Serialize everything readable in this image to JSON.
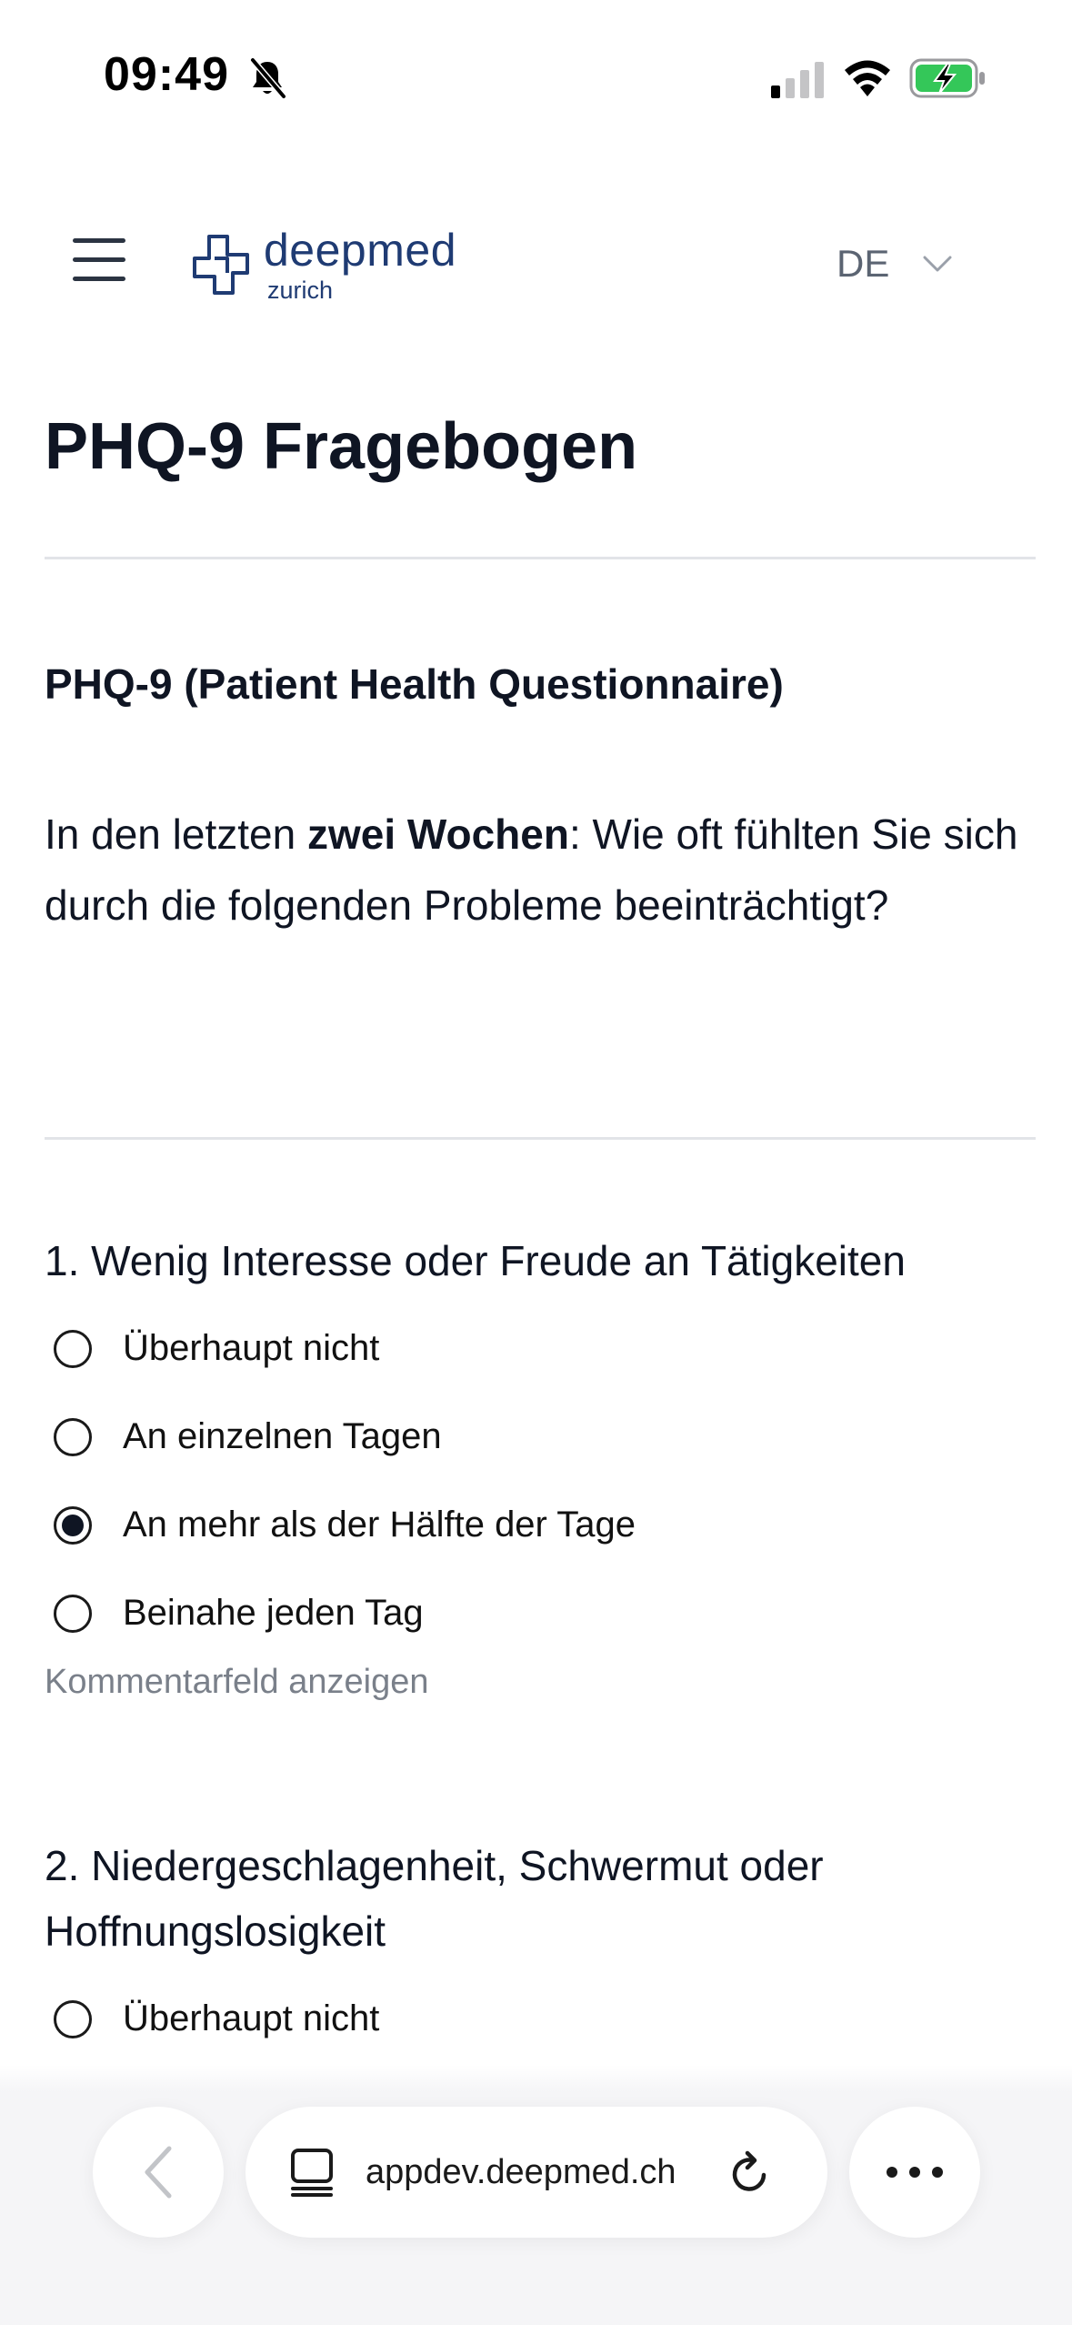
{
  "status_bar": {
    "time": "09:49",
    "icons": [
      "bell-slash-icon",
      "cellular-signal-icon",
      "wifi-icon",
      "battery-charging-icon"
    ],
    "battery_color": "#34c759"
  },
  "header": {
    "menu_icon": "hamburger-menu-icon",
    "logo": {
      "name": "deepmed",
      "sub": "zurich",
      "color": "#1f3b73"
    },
    "language": {
      "selected": "DE"
    }
  },
  "main": {
    "title": "PHQ-9 Fragebogen",
    "intro": {
      "heading": "PHQ-9 (Patient Health Questionnaire)",
      "text_before": "In den letzten ",
      "text_bold": "zwei Wochen",
      "text_after": ": Wie oft fühlten Sie sich durch die folgenden Probleme beeinträchtigt?"
    },
    "questions": [
      {
        "title": "1. Wenig Interesse oder Freude an Tätigkeiten",
        "options": [
          {
            "label": "Überhaupt nicht",
            "selected": false
          },
          {
            "label": "An einzelnen Tagen",
            "selected": false
          },
          {
            "label": "An mehr als der Hälfte der Tage",
            "selected": true
          },
          {
            "label": "Beinahe jeden Tag",
            "selected": false
          }
        ],
        "comment_link": "Kommentarfeld anzeigen"
      },
      {
        "title": "2. Niedergeschlagenheit, Schwermut oder Hoffnungslosigkeit",
        "options": [
          {
            "label": "Überhaupt nicht",
            "selected": false
          }
        ]
      }
    ]
  },
  "browser_bar": {
    "url": "appdev.deepmed.ch",
    "icons": [
      "back-arrow-icon",
      "tabs-icon",
      "reload-icon",
      "more-icon"
    ]
  }
}
